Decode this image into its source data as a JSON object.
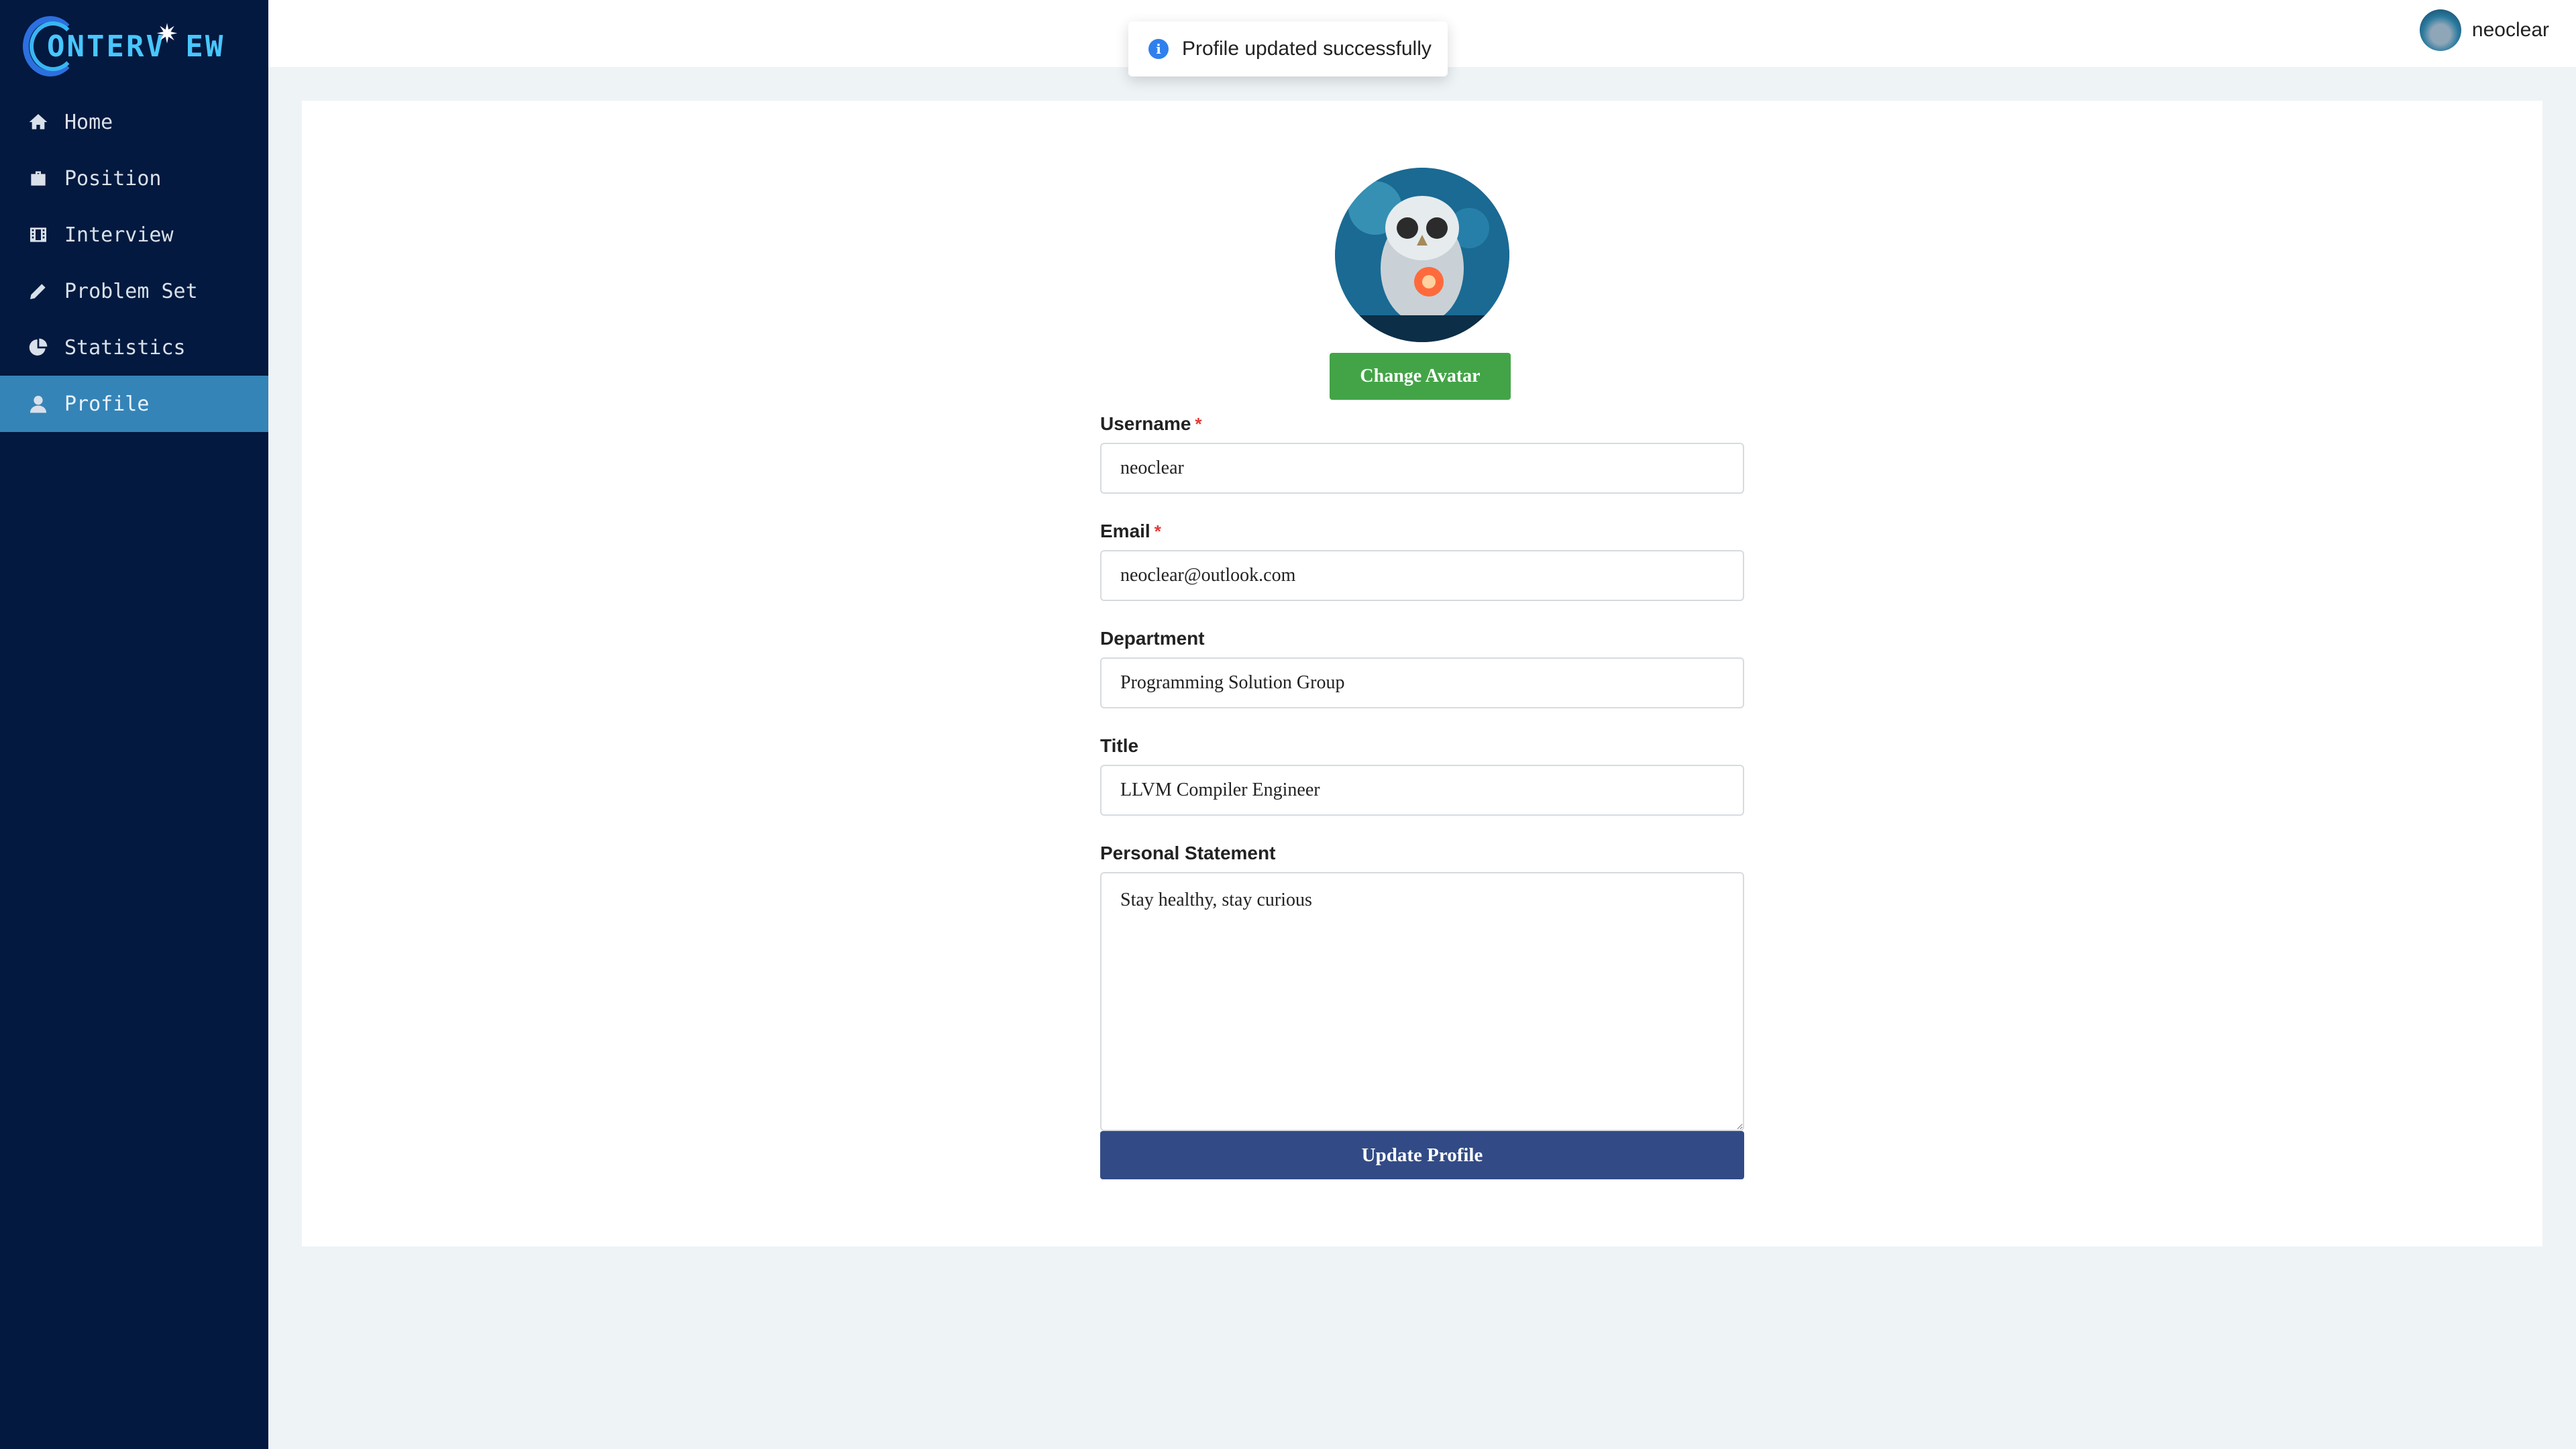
{
  "app": {
    "logo_text": "ONTERV EW"
  },
  "sidebar": {
    "items": [
      {
        "label": "Home",
        "icon": "home-icon"
      },
      {
        "label": "Position",
        "icon": "briefcase-icon"
      },
      {
        "label": "Interview",
        "icon": "film-icon"
      },
      {
        "label": "Problem Set",
        "icon": "pencil-icon"
      },
      {
        "label": "Statistics",
        "icon": "pie-chart-icon"
      },
      {
        "label": "Profile",
        "icon": "user-icon",
        "active": true
      }
    ]
  },
  "header": {
    "username": "neoclear"
  },
  "toast": {
    "message": "Profile updated successfully",
    "icon": "info-icon"
  },
  "profile": {
    "change_avatar_label": "Change Avatar",
    "fields": {
      "username": {
        "label": "Username",
        "required_mark": "*",
        "value": "neoclear"
      },
      "email": {
        "label": "Email",
        "required_mark": "*",
        "value": "neoclear@outlook.com"
      },
      "department": {
        "label": "Department",
        "value": "Programming Solution Group"
      },
      "title": {
        "label": "Title",
        "value": "LLVM Compiler Engineer"
      },
      "statement": {
        "label": "Personal Statement",
        "value": "Stay healthy, stay curious"
      }
    },
    "update_label": "Update Profile"
  },
  "colors": {
    "sidebar_bg": "#03193f",
    "sidebar_active": "#3584b7",
    "green_button": "#43a447",
    "primary_button": "#324b86",
    "page_bg": "#eef3f6"
  }
}
